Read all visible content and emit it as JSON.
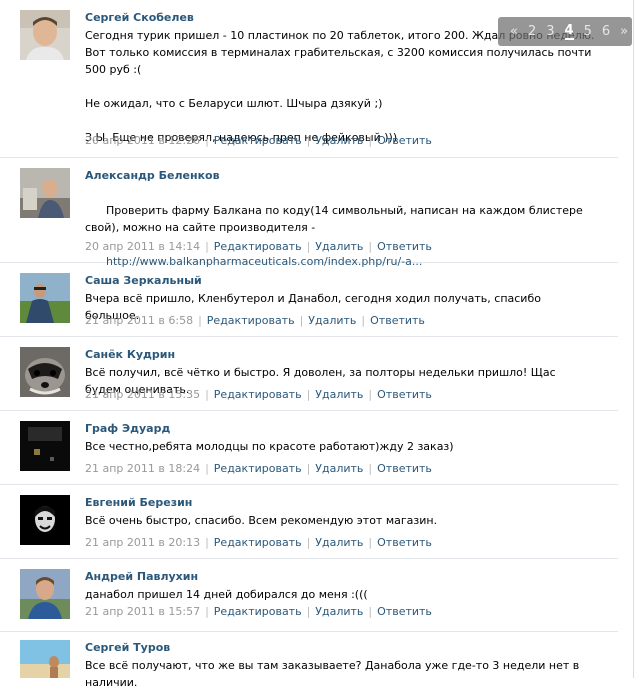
{
  "posts": [
    {
      "author": "Сергей Скобелев",
      "text": "Сегодня турик пришел - 10 пластинок по 20 таблеток, итого 200. Ждал ровно неделю. Вот только комиссия в терминалах грабительская, с 3200 комиссия получилась почти 500 руб :(\n\nНе ожидал, что с Беларуси шлют. Шчыра дзякуй ;)\n\nЗ.Ы. Еще не проверял, надеюсь преп не фейковый )))",
      "date": "20 апр 2011 в 12:26",
      "actions": [
        "Редактировать",
        "Удалить",
        "Ответить"
      ]
    },
    {
      "author": "Александр Беленков",
      "text": "Проверить фарму Балкана по коду(14 символьный, написан на каждом блистере свой), можно на сайте производителя -",
      "link": "http://www.balkanpharmaceuticals.com/index.php/ru/-a...",
      "date": "20 апр 2011 в 14:14",
      "actions": [
        "Редактировать",
        "Удалить",
        "Ответить"
      ]
    },
    {
      "author": "Саша Зеркальный",
      "text": "Вчера всё пришло, Кленбутерол и Данабол, сегодня ходил получать, спасибо большое.",
      "date": "21 апр 2011 в 6:58",
      "actions": [
        "Редактировать",
        "Удалить",
        "Ответить"
      ]
    },
    {
      "author": "Санёк Кудрин",
      "text": "Всё получил, всё чётко и быстро. Я доволен, за полторы недельки пришло! Щас будем оценивать.",
      "date": "21 апр 2011 в 15:35",
      "actions": [
        "Редактировать",
        "Удалить",
        "Ответить"
      ]
    },
    {
      "author": "Граф Эдуард",
      "text": "Все честно,ребята молодцы по красоте работают)жду 2 заказ)",
      "date": "21 апр 2011 в 18:24",
      "actions": [
        "Редактировать",
        "Удалить",
        "Ответить"
      ]
    },
    {
      "author": "Евгений Березин",
      "text": "Всё очень быстро, спасибо. Всем рекомендую этот магазин.",
      "date": "21 апр 2011 в 20:13",
      "actions": [
        "Редактировать",
        "Удалить",
        "Ответить"
      ]
    },
    {
      "author": "Андрей Павлухин",
      "text": "данабол пришел 14 дней добирался до меня :(((",
      "date": "21 апр 2011 в 15:57",
      "actions": [
        "Редактировать",
        "Удалить",
        "Ответить"
      ]
    },
    {
      "author": "Сергей Туров",
      "text": "Все всё получают, что же вы там заказываете? Данабола уже где-то 3 недели нет в наличии.",
      "date": "",
      "actions": []
    }
  ],
  "pager": {
    "prev": "«",
    "pages": [
      "2",
      "3",
      "4",
      "5",
      "6"
    ],
    "current": "4",
    "next": "»"
  }
}
